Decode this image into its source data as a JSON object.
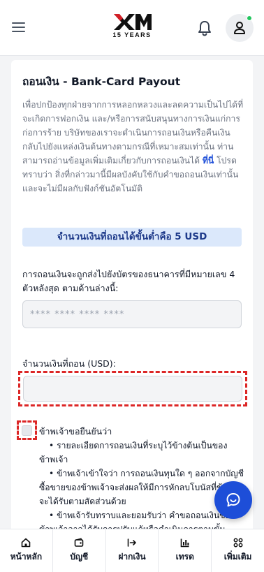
{
  "header": {
    "logo_text": "XM",
    "logo_sub": "15 YEARS"
  },
  "form": {
    "title": "ถอนเงิน - Bank-Card Payout",
    "description_before": "เพื่อปกป้องทุกฝ่ายจากการหลอกหลวงและลดความเป็นไปได้ที่จะเกิดการฟอกเงิน และ/หรือการสนับสนุนทางการเงินแก่การก่อการร้าย บริษัทของเราจะดำเนินการถอนเงินหรือคืนเงินกลับไปยังแหล่งเงินต้นทางตามกรณีที่เหมาะสมเท่านั้น ท่านสามารถอ่านข้อมูลเพิ่มเติมเกี่ยวกับการถอนเงินได้ ",
    "description_link": "ที่นี่",
    "description_after": " โปรดทราบว่า สิ่งที่กล่าวมานี้มีผลบังคับใช้กับคำขอถอนเงินเท่านั้นและจะไม่มีผลกับฟังก์ชันอัตโนมัติ",
    "min_banner": "จำนวนเงินที่ถอนได้ขั้นต่ำคือ 5 USD",
    "card_info": "การถอนเงินจะถูกส่งไปยังบัตรของธนาคารที่มีหมายเลข 4 ตัวหลังสุด ตามด้านล่างนี้:",
    "card_placeholder": "**** **** **** ****",
    "amount_label": "จำนวนเงินที่ถอน (USD):",
    "amount_value": "",
    "confirm_title": "ข้าพเจ้าขอยืนยันว่า",
    "confirm_items": [
      "• รายละเอียดการถอนเงินที่ระบุไว้ข้างต้นเป็นของข้าพเจ้า",
      "• ข้าพเจ้าเข้าใจว่า การถอนเงินทุนใด ๆ ออกจากบัญชีซื้อขายของข้าพเจ้าจะส่งผลให้มีการหักลบโบนัสที่ข้าพเจ้าจะได้รับตามสัดส่วนด้วย",
      "• ข้าพเจ้ารับทราบและยอมรับว่า คำขอถอนเงินของข้าพเจ้าอาจได้รับการปรับแก้หรือดำเนินการตามขั้น"
    ]
  },
  "bottom_nav": [
    {
      "label": "หน้าหลัก",
      "icon": "home-icon"
    },
    {
      "label": "บัญชี",
      "icon": "wallet-icon"
    },
    {
      "label": "ฝากเงิน",
      "icon": "deposit-icon"
    },
    {
      "label": "เทรด",
      "icon": "chart-icon"
    },
    {
      "label": "เพิ่มเติม",
      "icon": "grid-icon"
    }
  ],
  "colors": {
    "accent": "#1d4ed8",
    "highlight": "#dc2626",
    "banner_bg": "#dbe8fb"
  }
}
